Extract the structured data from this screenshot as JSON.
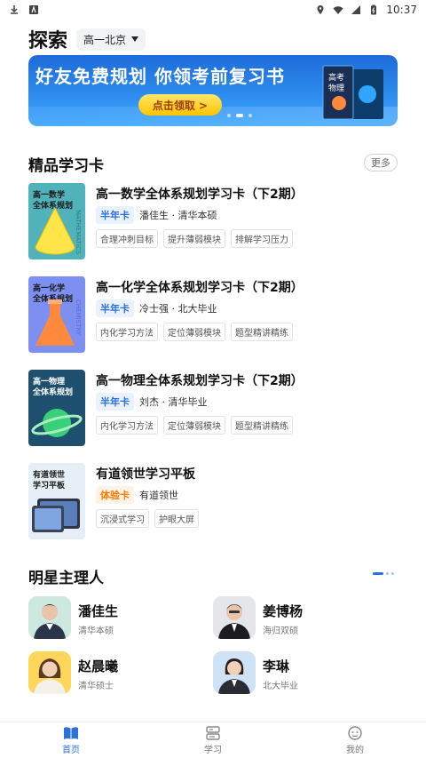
{
  "statusbar": {
    "time": "10:37"
  },
  "header": {
    "title": "探索",
    "grade": "高一北京"
  },
  "banner": {
    "headline": "好友免费规划 你领考前复习书",
    "cta": "点击领取 >",
    "book_text": "高考\n物理"
  },
  "premium": {
    "title": "精品学习卡",
    "more": "更多",
    "cards": [
      {
        "thumb_title": "高一数学\n全体系规划",
        "title": "高一数学全体系规划学习卡（下2期）",
        "badge": "半年卡",
        "author": "潘佳生 · 清华本硕",
        "tags": [
          "合理冲刺目标",
          "提升薄弱模块",
          "排解学习压力"
        ]
      },
      {
        "thumb_title": "高一化学\n全体系规划",
        "title": "高一化学全体系规划学习卡（下2期）",
        "badge": "半年卡",
        "author": "冷士强 · 北大毕业",
        "tags": [
          "内化学习方法",
          "定位薄弱模块",
          "题型精讲精练"
        ]
      },
      {
        "thumb_title": "高一物理\n全体系规划",
        "title": "高一物理全体系规划学习卡（下2期）",
        "badge": "半年卡",
        "author": "刘杰 · 清华毕业",
        "tags": [
          "内化学习方法",
          "定位薄弱模块",
          "题型精讲精练"
        ]
      },
      {
        "thumb_title": "有道领世\n学习平板",
        "title": "有道领世学习平板",
        "badge": "体验卡",
        "author": "有道领世",
        "tags": [
          "沉浸式学习",
          "护眼大屏"
        ]
      }
    ]
  },
  "tutors": {
    "title": "明星主理人",
    "items": [
      {
        "name": "潘佳生",
        "edu": "清华本硕"
      },
      {
        "name": "姜博杨",
        "edu": "海归双硕"
      },
      {
        "name": "赵晨曦",
        "edu": "清华硕士"
      },
      {
        "name": "李琳",
        "edu": "北大毕业"
      }
    ]
  },
  "nav": [
    {
      "label": "首页",
      "icon": "book-icon"
    },
    {
      "label": "学习",
      "icon": "study-icon"
    },
    {
      "label": "我的",
      "icon": "profile-icon"
    }
  ],
  "colors": {
    "accent": "#2b6fe0",
    "banner_top": "#1e6bd8"
  }
}
